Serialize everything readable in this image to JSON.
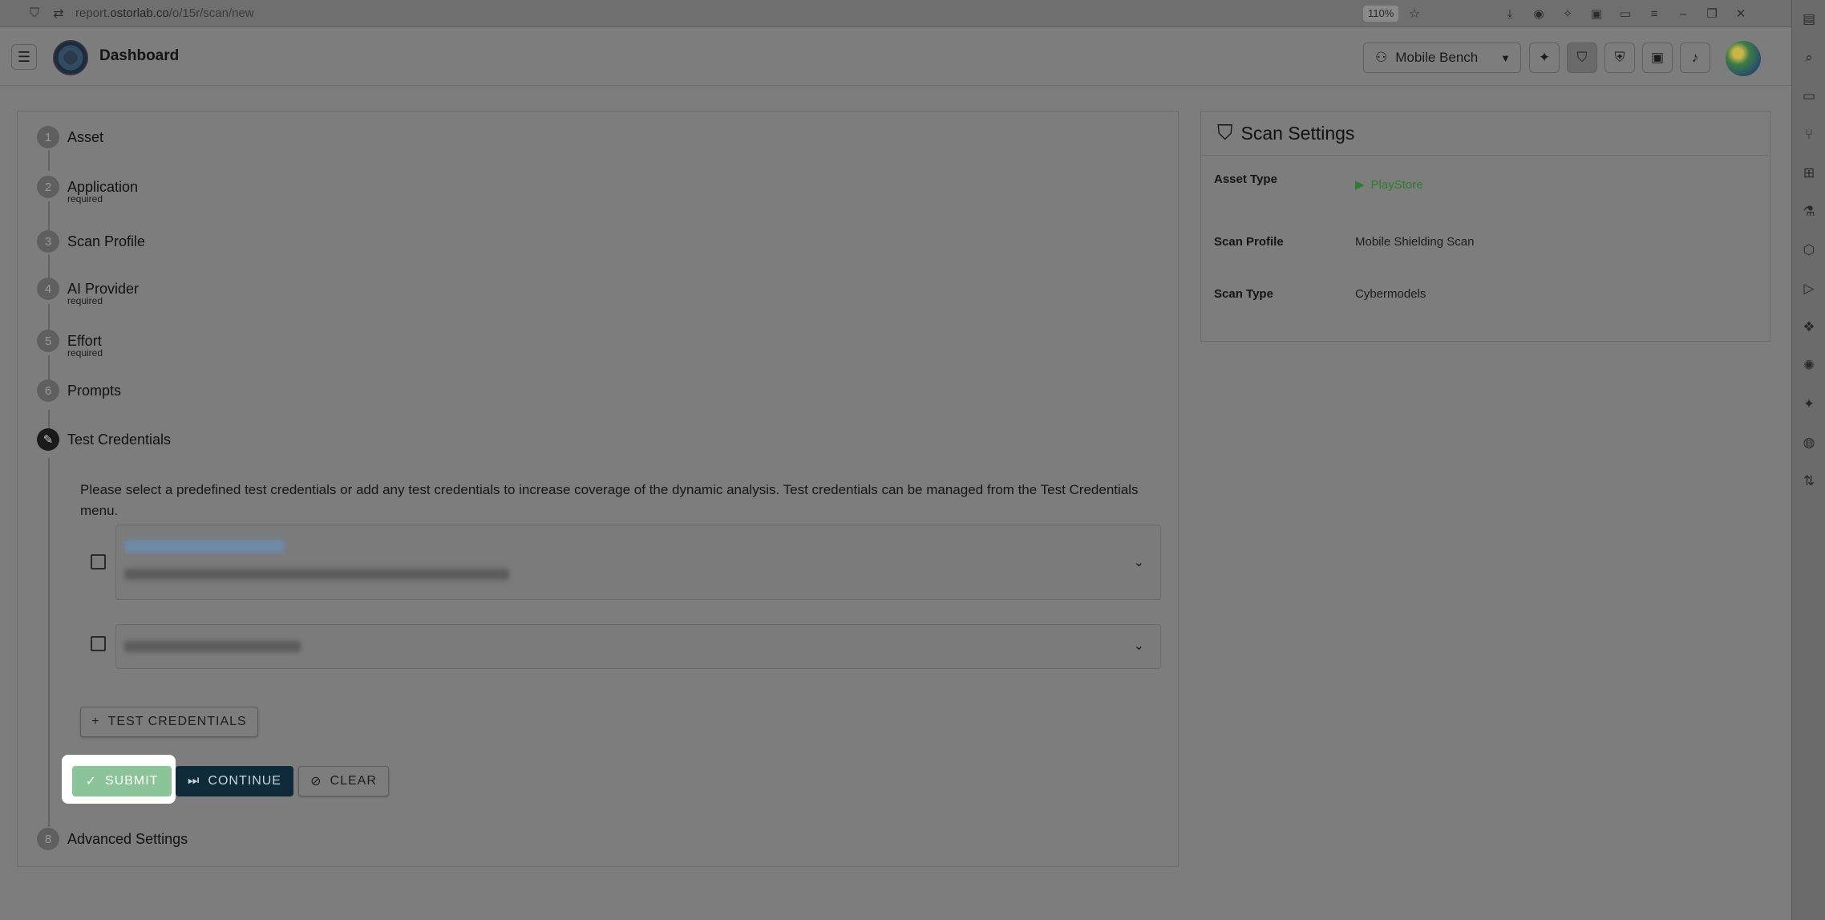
{
  "browser": {
    "url_prefix": "report.",
    "url_domain": "ostorlab.co",
    "url_path": "/o/15r/scan/new",
    "zoom": "110%"
  },
  "header": {
    "title": "Dashboard",
    "workspace": "Mobile Bench"
  },
  "steps": [
    {
      "num": "1",
      "label": "Asset",
      "sub": ""
    },
    {
      "num": "2",
      "label": "Application",
      "sub": "required"
    },
    {
      "num": "3",
      "label": "Scan Profile",
      "sub": ""
    },
    {
      "num": "4",
      "label": "AI Provider",
      "sub": "required"
    },
    {
      "num": "5",
      "label": "Effort",
      "sub": "required"
    },
    {
      "num": "6",
      "label": "Prompts",
      "sub": ""
    },
    {
      "num": "7",
      "label": "Test Credentials",
      "sub": ""
    },
    {
      "num": "8",
      "label": "Advanced Settings",
      "sub": ""
    }
  ],
  "credentials": {
    "description": "Please select a predefined test credentials or add any test credentials to increase coverage of the dynamic analysis. Test credentials can be managed from the Test Credentials menu.",
    "add_label": "Test Credentials"
  },
  "actions": {
    "submit": "Submit",
    "continue": "Continue",
    "clear": "Clear"
  },
  "settings": {
    "title": "Scan Settings",
    "rows": [
      {
        "key": "Asset Type",
        "value": "PlayStore"
      },
      {
        "key": "Scan Profile",
        "value": "Mobile Shielding Scan"
      },
      {
        "key": "Scan Type",
        "value": "Cybermodels"
      }
    ]
  },
  "colors": {
    "continue_bg": "#0f2b3a",
    "submit_bg": "#8cc49a",
    "playstore_green": "#2e7d32"
  }
}
